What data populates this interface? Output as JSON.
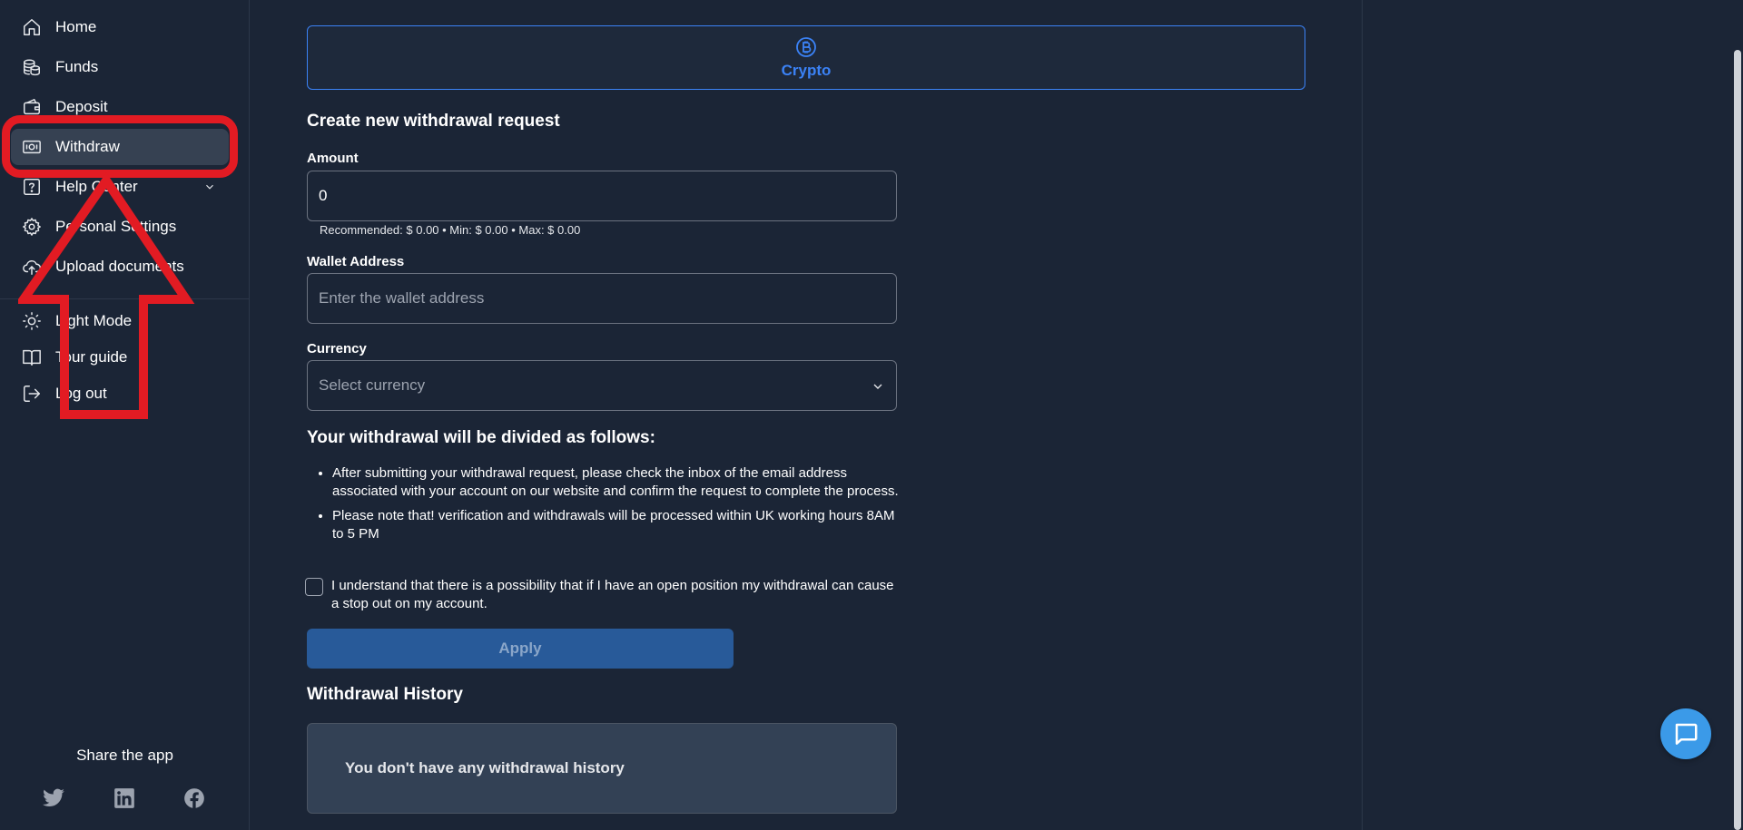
{
  "sidebar": {
    "items": [
      {
        "label": "Home",
        "icon": "home-icon"
      },
      {
        "label": "Funds",
        "icon": "coins-icon"
      },
      {
        "label": "Deposit",
        "icon": "wallet-icon"
      },
      {
        "label": "Withdraw",
        "icon": "banknote-icon"
      },
      {
        "label": "Help Center",
        "icon": "help-icon"
      },
      {
        "label": "Personal Settings",
        "icon": "gear-icon"
      },
      {
        "label": "Upload documents",
        "icon": "cloud-upload-icon"
      }
    ],
    "secondary_items": [
      {
        "label": "Light Mode",
        "icon": "sun-icon"
      },
      {
        "label": "Tour guide",
        "icon": "book-icon"
      },
      {
        "label": "Log out",
        "icon": "logout-icon"
      }
    ],
    "active_item": "Withdraw",
    "share_label": "Share the app",
    "social": [
      "twitter-icon",
      "linkedin-icon",
      "facebook-icon"
    ]
  },
  "main": {
    "method_tab": {
      "label": "Crypto",
      "icon": "bitcoin-icon"
    },
    "form_title": "Create new withdrawal request",
    "amount": {
      "label": "Amount",
      "value": "0",
      "hint": "Recommended: $ 0.00 • Min: $ 0.00 • Max: $ 0.00"
    },
    "wallet": {
      "label": "Wallet Address",
      "placeholder": "Enter the wallet address"
    },
    "currency": {
      "label": "Currency",
      "placeholder": "Select currency"
    },
    "division_title": "Your withdrawal will be divided as follows:",
    "notes": [
      "After submitting your withdrawal request, please check the inbox of the email address associated with your account on our website and confirm the request to complete the process.",
      "Please note that! verification and withdrawals will be processed within UK working hours 8AM to 5 PM"
    ],
    "agreement": "I understand that there is a possibility that if I have an open position my withdrawal can cause a stop out on my account.",
    "apply_label": "Apply",
    "history_title": "Withdrawal History",
    "history_empty": "You don't have any withdrawal history"
  },
  "colors": {
    "background": "#1b2536",
    "accent": "#3b82f6",
    "annotation_red": "#e21b23",
    "apply_button": "#285a99",
    "chat_button": "#3b9ae8"
  }
}
